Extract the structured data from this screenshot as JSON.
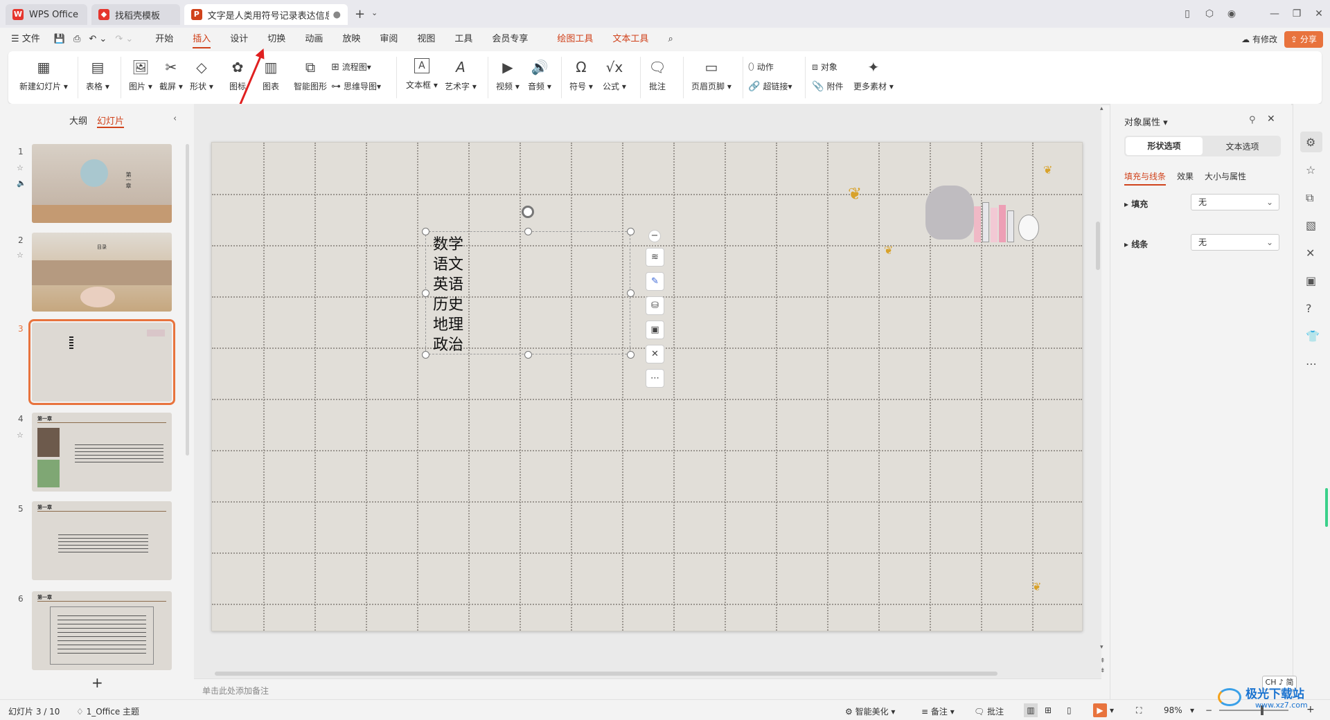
{
  "tabs": [
    {
      "label": "WPS Office",
      "color": "#e5352d"
    },
    {
      "label": "找稻壳模板",
      "color": "#e5352d"
    },
    {
      "label": "文字是人类用符号记录表达信息以",
      "color": "#d0421b"
    }
  ],
  "menu": {
    "file": "文件",
    "items": [
      "开始",
      "插入",
      "设计",
      "切换",
      "动画",
      "放映",
      "审阅",
      "视图",
      "工具",
      "会员专享"
    ],
    "active": "插入",
    "tool_tabs": [
      "绘图工具",
      "文本工具"
    ],
    "modified": "有修改",
    "share": "分享"
  },
  "ribbon": {
    "new_slide": "新建幻灯片",
    "table": "表格",
    "picture": "图片",
    "screenshot": "截屏",
    "shape": "形状",
    "icon": "图标",
    "chart": "图表",
    "smartart": "智能图形",
    "flowchart": "流程图",
    "mindmap": "思维导图",
    "textbox": "文本框",
    "wordart": "艺术字",
    "video": "视频",
    "audio": "音频",
    "symbol": "符号",
    "formula": "公式",
    "comment": "批注",
    "header_footer": "页眉页脚",
    "action": "动作",
    "hyperlink": "超链接",
    "object": "对象",
    "attachment": "附件",
    "more": "更多素材"
  },
  "left_panel": {
    "tab_outline": "大纲",
    "tab_slides": "幻灯片",
    "slides": [
      "1",
      "2",
      "3",
      "4",
      "5",
      "6"
    ],
    "thumb_texts": {
      "s1": "第一章",
      "s2": "目录",
      "s4": "第一章",
      "s5": "第一章",
      "s6": "第一章"
    },
    "selected": "3"
  },
  "slide_text": [
    "数学",
    "语文",
    "英语",
    "历史",
    "地理",
    "政治"
  ],
  "notes_placeholder": "单击此处添加备注",
  "right_panel": {
    "title": "对象属性",
    "seg_shape": "形状选项",
    "seg_text": "文本选项",
    "sub_tabs": [
      "填充与线条",
      "效果",
      "大小与属性"
    ],
    "fill_label": "填充",
    "fill_value": "无",
    "line_label": "线条",
    "line_value": "无"
  },
  "status": {
    "slide_info": "幻灯片 3 / 10",
    "theme": "1_Office 主题",
    "beautify": "智能美化",
    "notes": "备注",
    "comments": "批注",
    "zoom": "98%",
    "ime": "CH ♪ 简"
  },
  "watermark": {
    "brand": "极光下载站",
    "url": "www.xz7.com"
  }
}
